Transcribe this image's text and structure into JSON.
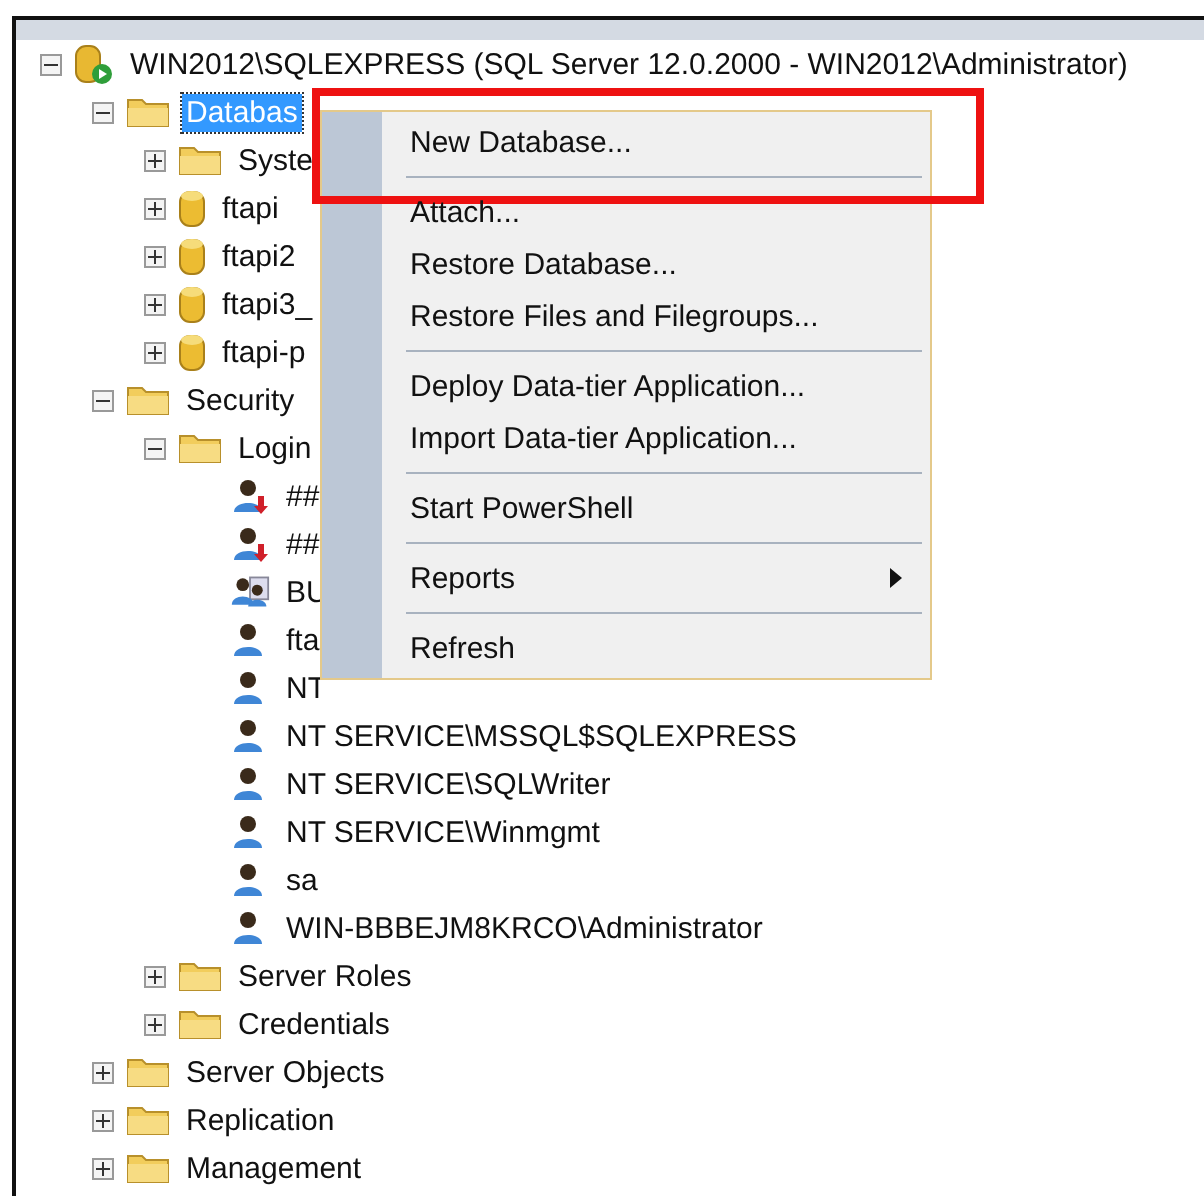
{
  "tree": [
    {
      "label": "WIN2012\\SQLEXPRESS (SQL Server 12.0.2000 - WIN2012\\Administrator)",
      "kind": "server",
      "expanded": true,
      "selected": false,
      "children": [
        {
          "label": "Databas",
          "kind": "folder",
          "expanded": true,
          "selected": true,
          "children": [
            {
              "label": "Syste",
              "kind": "folder",
              "expanded": false,
              "selected": false
            },
            {
              "label": "ftapi",
              "kind": "database",
              "expanded": false,
              "selected": false
            },
            {
              "label": "ftapi2",
              "kind": "database",
              "expanded": false,
              "selected": false
            },
            {
              "label": "ftapi3_",
              "kind": "database",
              "expanded": false,
              "selected": false
            },
            {
              "label": "ftapi-p",
              "kind": "database",
              "expanded": false,
              "selected": false
            }
          ]
        },
        {
          "label": "Security",
          "kind": "folder",
          "expanded": true,
          "selected": false,
          "children": [
            {
              "label": "Login",
              "kind": "folder",
              "expanded": true,
              "selected": false,
              "children": [
                {
                  "label": "##",
                  "kind": "disabled-login",
                  "selected": false
                },
                {
                  "label": "##",
                  "kind": "disabled-login",
                  "selected": false
                },
                {
                  "label": "BU",
                  "kind": "group-login",
                  "selected": false
                },
                {
                  "label": "fta",
                  "kind": "login",
                  "selected": false
                },
                {
                  "label": "NT",
                  "kind": "login",
                  "selected": false
                },
                {
                  "label": "NT SERVICE\\MSSQL$SQLEXPRESS",
                  "kind": "login",
                  "selected": false
                },
                {
                  "label": "NT SERVICE\\SQLWriter",
                  "kind": "login",
                  "selected": false
                },
                {
                  "label": "NT SERVICE\\Winmgmt",
                  "kind": "login",
                  "selected": false
                },
                {
                  "label": "sa",
                  "kind": "login",
                  "selected": false
                },
                {
                  "label": "WIN-BBBEJM8KRCO\\Administrator",
                  "kind": "login",
                  "selected": false
                }
              ]
            },
            {
              "label": "Server Roles",
              "kind": "folder",
              "expanded": false,
              "selected": false
            },
            {
              "label": "Credentials",
              "kind": "folder",
              "expanded": false,
              "selected": false
            }
          ]
        },
        {
          "label": "Server Objects",
          "kind": "folder",
          "expanded": false,
          "selected": false
        },
        {
          "label": "Replication",
          "kind": "folder",
          "expanded": false,
          "selected": false
        },
        {
          "label": "Management",
          "kind": "folder",
          "expanded": false,
          "selected": false
        }
      ]
    }
  ],
  "context_menu": [
    {
      "kind": "item",
      "label": "New Database...",
      "annotated": true
    },
    {
      "kind": "separator"
    },
    {
      "kind": "item",
      "label": "Attach...",
      "annotated": false
    },
    {
      "kind": "item",
      "label": "Restore Database...",
      "annotated": false
    },
    {
      "kind": "item",
      "label": "Restore Files and Filegroups...",
      "annotated": false
    },
    {
      "kind": "separator"
    },
    {
      "kind": "item",
      "label": "Deploy Data-tier Application...",
      "annotated": false
    },
    {
      "kind": "item",
      "label": "Import Data-tier Application...",
      "annotated": false
    },
    {
      "kind": "separator"
    },
    {
      "kind": "item",
      "label": "Start PowerShell",
      "annotated": false
    },
    {
      "kind": "separator"
    },
    {
      "kind": "submenu",
      "label": "Reports",
      "annotated": false
    },
    {
      "kind": "separator"
    },
    {
      "kind": "item",
      "label": "Refresh",
      "annotated": false
    }
  ]
}
